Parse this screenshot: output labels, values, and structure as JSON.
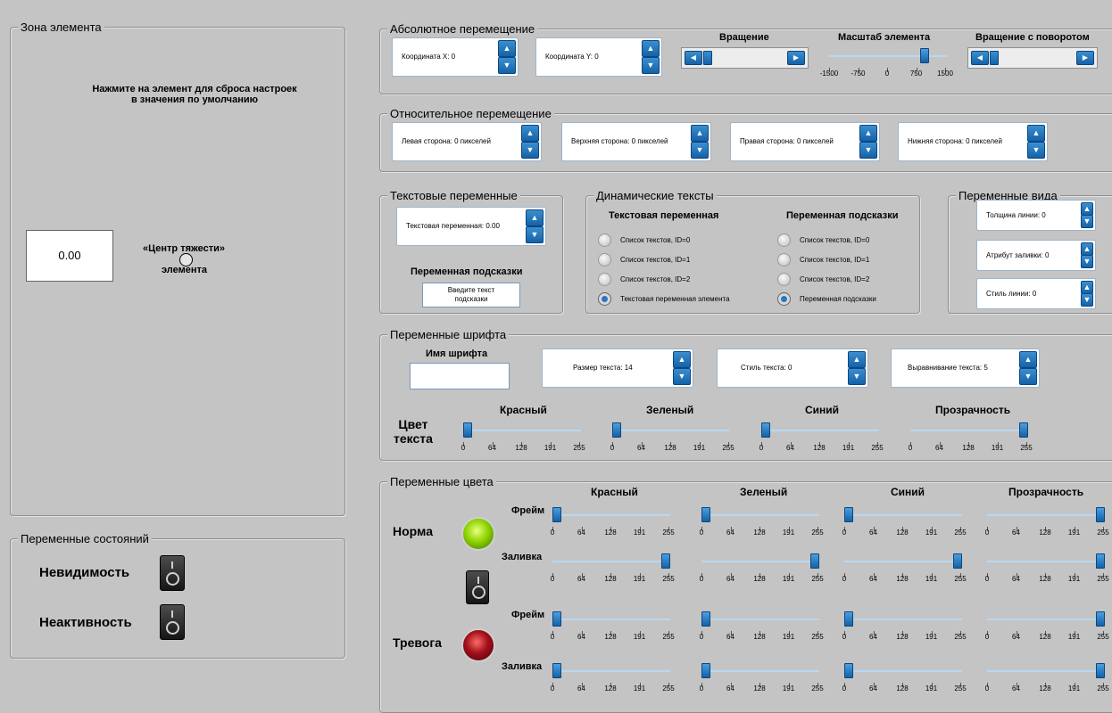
{
  "zone": {
    "title": "Зона элемента",
    "hint": "Нажмите на элемент для сброса настроек\nв значения по умолчанию",
    "value": "0.00",
    "center_line1": "«Центр тяжести»",
    "center_line2": "элемента"
  },
  "states": {
    "title": "Переменные состояний",
    "invisible": "Невидимость",
    "inactive": "Неактивность"
  },
  "absolute": {
    "title": "Абсолютное перемещение",
    "x": "Координата X: 0",
    "y": "Координата Y: 0",
    "rotation": "Вращение",
    "scale": "Масштаб элемента",
    "rotate_turn": "Вращение с поворотом",
    "scale_ticks": [
      "-1500",
      "-750",
      "0",
      "750",
      "1500"
    ],
    "scale_value": 1000
  },
  "relative": {
    "title": "Относительное перемещение",
    "left": "Левая сторона: 0 пикселей",
    "top": "Верхняя сторона: 0 пикселей",
    "right": "Правая сторона: 0 пикселей",
    "bottom": "Нижняя сторона: 0 пикселей"
  },
  "textvars": {
    "title": "Текстовые переменные",
    "spin": "Текстовая переменная: 0.00",
    "hint_label": "Переменная подсказки",
    "hint_input": "Введите текст подсказки"
  },
  "dyn": {
    "title": "Динамические тексты",
    "col1": "Текстовая переменная",
    "col2": "Переменная подсказки",
    "items1": [
      "Список текстов, ID=0",
      "Список текстов, ID=1",
      "Список текстов, ID=2",
      "Текстовая переменная элемента"
    ],
    "items2": [
      "Список текстов, ID=0",
      "Список текстов, ID=1",
      "Список текстов, ID=2",
      "Переменная подсказки"
    ],
    "selected_index": 3
  },
  "view": {
    "title": "Переменные вида",
    "line_width": "Толщина линии: 0",
    "fill": "Атрибут заливки: 0",
    "line_style": "Стиль линии: 0"
  },
  "font": {
    "title": "Переменные шрифта",
    "name_label": "Имя шрифта",
    "size": "Размер текста: 14",
    "style": "Стиль текста: 0",
    "align": "Выравнивание текста: 5",
    "color_label1": "Цвет",
    "color_label2": "текста",
    "channels": [
      "Красный",
      "Зеленый",
      "Синий",
      "Прозрачность"
    ],
    "values": [
      0,
      0,
      0,
      255
    ]
  },
  "ticks": [
    "0",
    "64",
    "128",
    "191",
    "255"
  ],
  "colors": {
    "title": "Переменные цвета",
    "channels": [
      "Красный",
      "Зеленый",
      "Синий",
      "Прозрачность"
    ],
    "norm": "Норма",
    "alarm": "Тревога",
    "frame": "Фрейм",
    "fill": "Заливка",
    "norm_frame": [
      0,
      0,
      0,
      255
    ],
    "norm_fill": [
      255,
      255,
      255,
      255
    ],
    "alarm_frame": [
      0,
      0,
      0,
      255
    ],
    "alarm_fill": [
      0,
      0,
      0,
      255
    ],
    "norm_lamp": "#8fd400",
    "alarm_lamp": "#a0101a"
  },
  "accent": "#1a6fbf"
}
